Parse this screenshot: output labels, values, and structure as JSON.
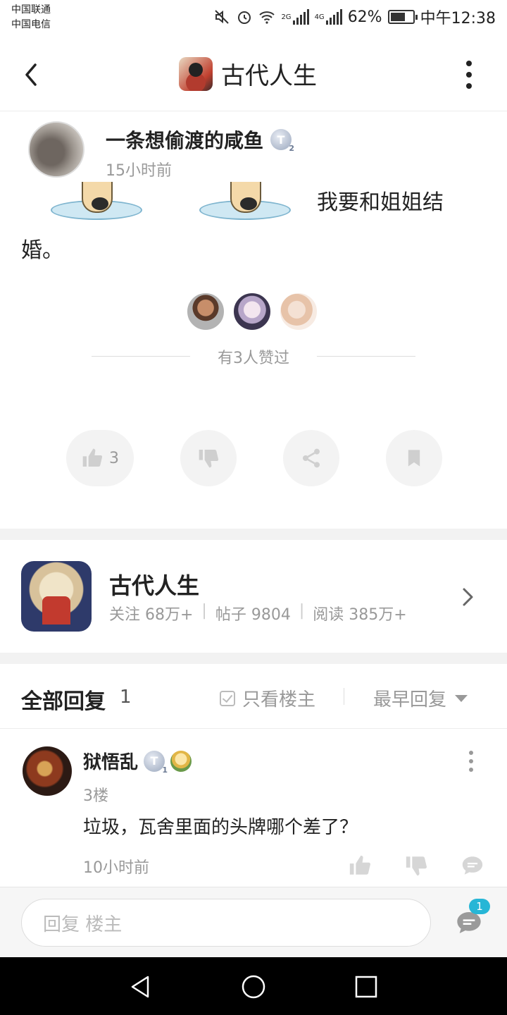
{
  "status_bar": {
    "carrier1": "中国联通",
    "carrier2": "中国电信",
    "net1": "2G",
    "net2": "4G",
    "battery": "62%",
    "time": "中午12:38"
  },
  "header": {
    "title": "古代人生"
  },
  "post": {
    "author": "一条想偷渡的咸鱼",
    "author_badge": "T",
    "author_badge_level": "2",
    "time": "15小时前",
    "content_line1": "我要和姐姐结",
    "content_line2": "婚。",
    "likes_text": "有3人赞过",
    "like_count": "3"
  },
  "forum": {
    "name": "古代人生",
    "follow": "关注 68万+",
    "posts": "帖子 9804",
    "reads": "阅读 385万+",
    "sep": "|"
  },
  "replies_header": {
    "title": "全部回复",
    "count": "1",
    "only_owner": "只看楼主",
    "sort": "最早回复"
  },
  "reply": {
    "author": "狱悟乱",
    "badge": "T",
    "badge_level": "1",
    "floor": "3楼",
    "text": "垃圾，瓦舍里面的头牌哪个差了？",
    "time": "10小时前"
  },
  "input": {
    "placeholder": "回复  楼主",
    "comment_badge": "1"
  },
  "colors": {
    "accent": "#27b6d6",
    "muted": "#999999"
  }
}
